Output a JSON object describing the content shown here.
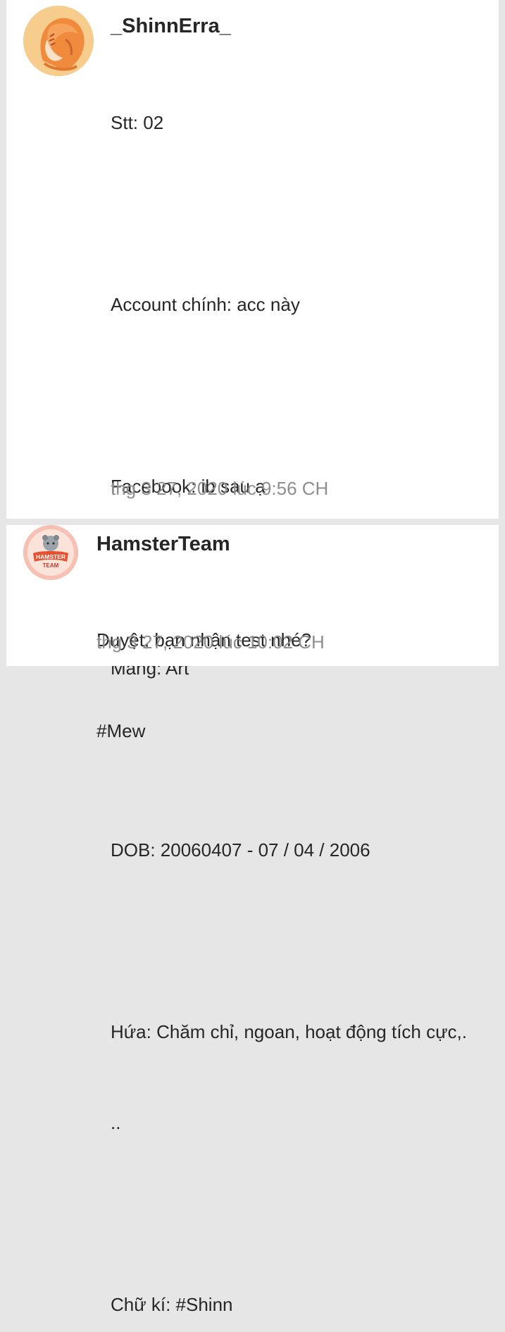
{
  "comments": [
    {
      "username": "_ShinnErra_",
      "lines": [
        "Stt: 02",
        "",
        "Account chính: acc này",
        "",
        "Facebook: ib sau ạ",
        "",
        "Mảng: Art",
        "",
        "DOB: 20060407 - 07 / 04 / 2006",
        "",
        "Hứa: Chăm chỉ, ngoan, hoạt động tích cực,.",
        "..",
        "",
        "Chữ kí: #Shinn"
      ],
      "timestamp": "thg 3 27, 2020 lúc 9:56 CH",
      "avatar_icon": "orange-anime-character-avatar"
    },
    {
      "username": "HamsterTeam",
      "lines": [
        "Duyệt, bạn nhận test nhé?",
        "#Mew"
      ],
      "timestamp": "thg 3 27, 2020 lúc 10:02 CH",
      "avatar_icon": "hamster-team-logo-avatar",
      "avatar_logo_text": "HAMSTER TEAM"
    }
  ],
  "colors": {
    "background": "#e6e6e6",
    "card": "#ffffff",
    "text": "#262626",
    "timestamp": "#8e8e8e"
  }
}
